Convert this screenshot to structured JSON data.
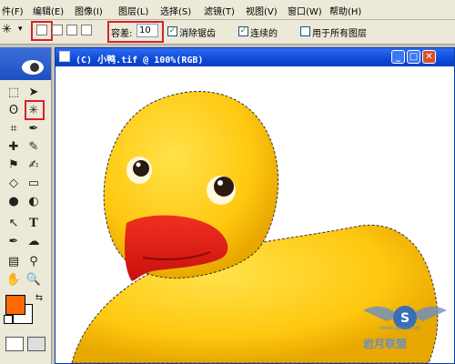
{
  "menubar": {
    "items": [
      "件(F)",
      "编辑(E)",
      "图像(I)",
      "图层(L)",
      "选择(S)",
      "滤镜(T)",
      "视图(V)",
      "窗口(W)",
      "帮助(H)"
    ]
  },
  "options_bar": {
    "tolerance_label": "容差:",
    "tolerance_value": "10",
    "anti_alias_label": "消除锯齿",
    "anti_alias_checked": true,
    "contiguous_label": "连续的",
    "contiguous_checked": true,
    "all_layers_label": "用于所有图层",
    "all_layers_checked": false
  },
  "document": {
    "title": "(C) 小鸭.tif @ 100%(RGB)"
  },
  "toolbox": {
    "foreground_color": "#ff6a00",
    "background_color": "#ffffff",
    "tools": [
      "marquee-tool",
      "move-tool",
      "lasso-tool",
      "magic-wand-tool",
      "crop-tool",
      "slice-tool",
      "healing-brush-tool",
      "brush-tool",
      "clone-stamp-tool",
      "history-brush-tool",
      "eraser-tool",
      "gradient-tool",
      "blur-tool",
      "dodge-tool",
      "path-selection-tool",
      "type-tool",
      "pen-tool",
      "shape-tool",
      "notes-tool",
      "eyedropper-tool",
      "hand-tool",
      "zoom-tool"
    ]
  },
  "watermark": {
    "text": "岩月联盟",
    "url": "www.ayuu.com"
  },
  "colors": {
    "highlight": "#d8202a",
    "duck": "#ffd21a",
    "beak": "#e8201c"
  }
}
